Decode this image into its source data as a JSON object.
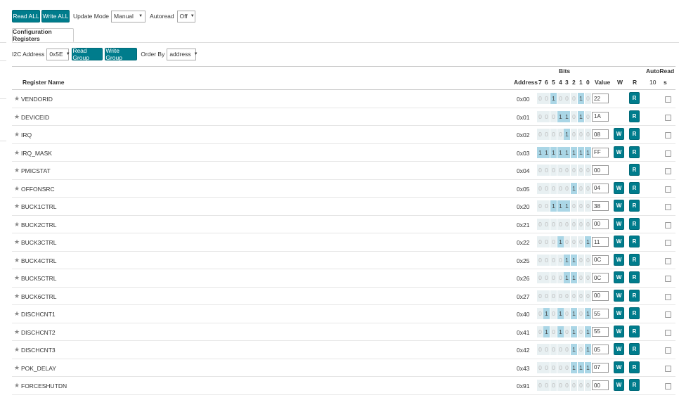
{
  "toolbar": {
    "read_all": "Read ALL",
    "write_all": "Write ALL",
    "update_mode_label": "Update Mode",
    "update_mode_value": "Manual",
    "autoread_label": "Autoread",
    "autoread_value": "Off"
  },
  "tabs": [
    "Configuration Registers"
  ],
  "controls": {
    "i2c_label": "I2C Address",
    "i2c_value": "0x5E",
    "read_group": "Read Group",
    "write_group": "Write Group",
    "order_by_label": "Order By",
    "order_by_value": "address"
  },
  "table": {
    "bits_header": "Bits",
    "autoread_header": "AutoRead",
    "col_name": "Register Name",
    "col_address": "Address",
    "bit_labels": [
      "7",
      "6",
      "5",
      "4",
      "3",
      "2",
      "1",
      "0"
    ],
    "col_value": "Value",
    "col_w": "W",
    "col_r": "R",
    "autoread_sub1": "10",
    "autoread_sub2": "s",
    "w_label": "W",
    "r_label": "R",
    "rows": [
      {
        "name": "VENDORID",
        "address": "0x00",
        "value": "22",
        "writable": false,
        "bits": "00100010"
      },
      {
        "name": "DEVICEID",
        "address": "0x01",
        "value": "1A",
        "writable": false,
        "bits": "00011010"
      },
      {
        "name": "IRQ",
        "address": "0x02",
        "value": "08",
        "writable": true,
        "bits": "00001000"
      },
      {
        "name": "IRQ_MASK",
        "address": "0x03",
        "value": "FF",
        "writable": true,
        "bits": "11111111"
      },
      {
        "name": "PMICSTAT",
        "address": "0x04",
        "value": "00",
        "writable": false,
        "bits": "00000000"
      },
      {
        "name": "OFFONSRC",
        "address": "0x05",
        "value": "04",
        "writable": true,
        "bits": "00000100"
      },
      {
        "name": "BUCK1CTRL",
        "address": "0x20",
        "value": "38",
        "writable": true,
        "bits": "00111000"
      },
      {
        "name": "BUCK2CTRL",
        "address": "0x21",
        "value": "00",
        "writable": true,
        "bits": "00000000"
      },
      {
        "name": "BUCK3CTRL",
        "address": "0x22",
        "value": "11",
        "writable": true,
        "bits": "00010001"
      },
      {
        "name": "BUCK4CTRL",
        "address": "0x25",
        "value": "0C",
        "writable": true,
        "bits": "00001100"
      },
      {
        "name": "BUCK5CTRL",
        "address": "0x26",
        "value": "0C",
        "writable": true,
        "bits": "00001100"
      },
      {
        "name": "BUCK6CTRL",
        "address": "0x27",
        "value": "00",
        "writable": true,
        "bits": "00000000"
      },
      {
        "name": "DISCHCNT1",
        "address": "0x40",
        "value": "55",
        "writable": true,
        "bits": "01010101"
      },
      {
        "name": "DISCHCNT2",
        "address": "0x41",
        "value": "55",
        "writable": true,
        "bits": "01010101"
      },
      {
        "name": "DISCHCNT3",
        "address": "0x42",
        "value": "05",
        "writable": true,
        "bits": "00000101"
      },
      {
        "name": "POK_DELAY",
        "address": "0x43",
        "value": "07",
        "writable": true,
        "bits": "00000111"
      },
      {
        "name": "FORCESHUTDN",
        "address": "0x91",
        "value": "00",
        "writable": true,
        "bits": "00000000"
      }
    ]
  },
  "colors": {
    "accent": "#007c8c",
    "bit_on": "#aad6e6",
    "bit_off": "#e8f0f2"
  },
  "icons": {
    "favorite": "star-icon"
  }
}
